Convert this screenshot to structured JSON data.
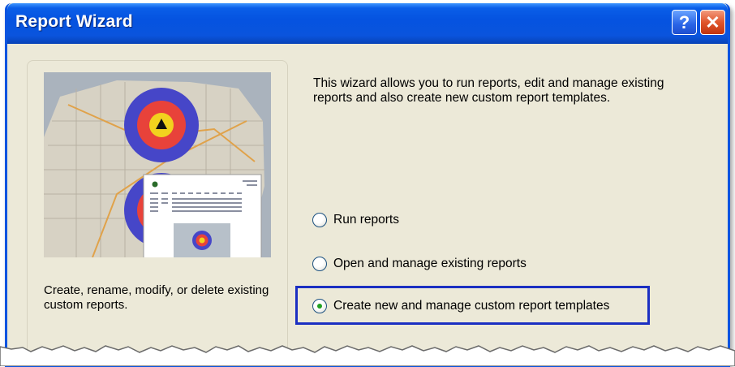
{
  "window": {
    "title": "Report Wizard",
    "help_icon_glyph": "?",
    "close_icon_glyph": "✕"
  },
  "left_panel": {
    "description": "Create, rename, modify, or delete existing custom reports."
  },
  "intro_text": "This wizard allows you to run reports, edit and manage existing reports and also create new custom report templates.",
  "options": [
    {
      "label": "Run reports",
      "selected": false
    },
    {
      "label": "Open and manage existing reports",
      "selected": false
    },
    {
      "label": "Create new and manage custom report templates",
      "selected": true
    }
  ],
  "colors": {
    "titlebar": "#0553e0",
    "highlight_border": "#1b2fc2",
    "radio_dot": "#21a121"
  }
}
